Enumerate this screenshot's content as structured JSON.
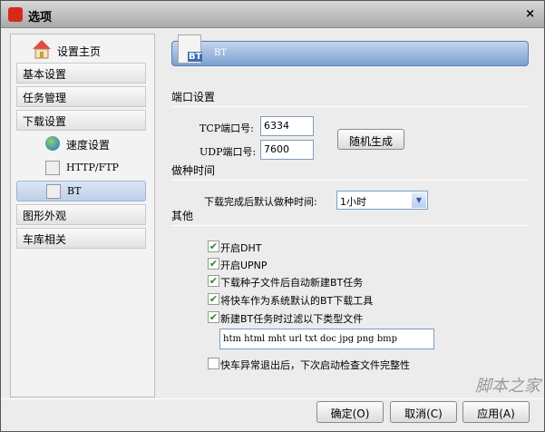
{
  "window": {
    "title": "选项",
    "close": "×"
  },
  "sidebar": {
    "home": "设置主页",
    "items": [
      {
        "label": "基本设置"
      },
      {
        "label": "任务管理"
      },
      {
        "label": "下载设置"
      },
      {
        "label": "图形外观"
      },
      {
        "label": "车库相关"
      }
    ],
    "sub_items": [
      {
        "label": "速度设置",
        "icon": "globe-icon"
      },
      {
        "label": "HTTP/FTP",
        "icon": "http-file-icon"
      },
      {
        "label": "BT",
        "icon": "bt-file-icon",
        "selected": true
      }
    ]
  },
  "header": {
    "title": "BT",
    "icon_text": "BT"
  },
  "port": {
    "section": "端口设置",
    "tcp_label": "TCP端口号:",
    "tcp_value": "6334",
    "udp_label": "UDP端口号:",
    "udp_value": "7600",
    "random_button": "随机生成"
  },
  "seeding": {
    "section": "做种时间",
    "label": "下载完成后默认做种时间:",
    "value": "1小时"
  },
  "other": {
    "section": "其他",
    "options": [
      {
        "label": "开启DHT",
        "checked": true
      },
      {
        "label": "开启UPNP",
        "checked": true
      },
      {
        "label": "下载种子文件后自动新建BT任务",
        "checked": true
      },
      {
        "label": "将快车作为系统默认的BT下载工具",
        "checked": true
      },
      {
        "label": "新建BT任务时过滤以下类型文件",
        "checked": true
      }
    ],
    "filter_value": "htm html mht url txt doc jpg png bmp",
    "integrity": {
      "label": "快车异常退出后，下次启动检查文件完整性",
      "checked": false
    }
  },
  "footer": {
    "ok": "确定(O)",
    "cancel": "取消(C)",
    "apply": "应用(A)"
  },
  "watermark": "脚本之家"
}
